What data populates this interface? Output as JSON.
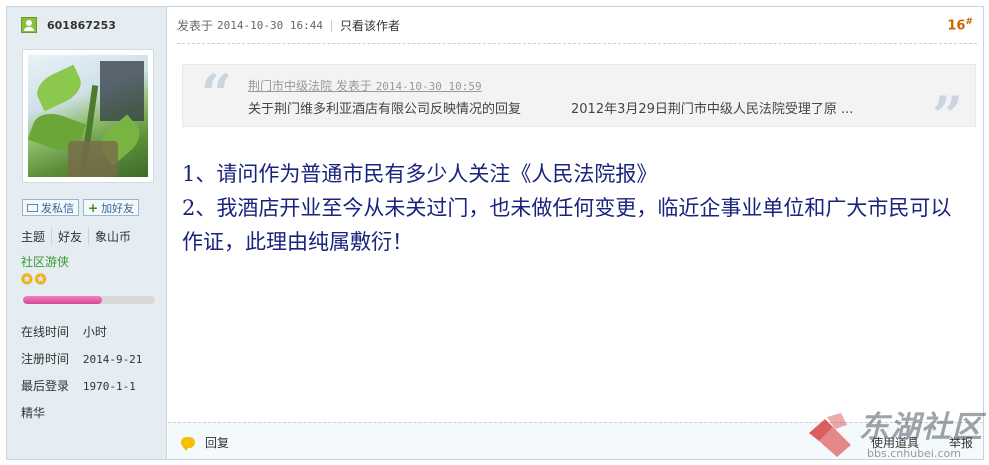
{
  "user": {
    "name": "601867253",
    "send_message": "发私信",
    "add_friend": "加好友",
    "stats": [
      "主题",
      "好友",
      "象山币"
    ],
    "group": "社区游侠",
    "level_progress": 0.6,
    "online_label": "在线时间",
    "online_value": "小时",
    "register_label": "注册时间",
    "register_value": "2014-9-21",
    "last_login_label": "最后登录",
    "last_login_value": "1970-1-1",
    "essence_label": "精华"
  },
  "post": {
    "posted_label": "发表于",
    "posted_date": "2014-10-30 16:44",
    "only_author": "只看该作者",
    "floor_num": "16",
    "floor_mark": "#"
  },
  "quote": {
    "author": "荆门市中级法院",
    "posted_label": "发表于",
    "posted_date": "2014-10-30 10:59",
    "title": "关于荆门维多利亚酒店有限公司反映情况的回复",
    "excerpt": "2012年3月29日荆门市中级人民法院受理了原 ..."
  },
  "body": {
    "line1": "1、请问作为普通市民有多少人关注《人民法院报》",
    "line2": "2、我酒店开业至今从未关过门，也未做任何变更，临近企事业单位和广大市民可以作证，此理由纯属敷衍！"
  },
  "footer": {
    "reply": "回复",
    "use_item": "使用道具",
    "report": "举报"
  },
  "watermark": {
    "brand": "东湖社区",
    "url": "bbs.cnhubei.com"
  },
  "colors": {
    "sidebar_bg": "#e5edf2",
    "body_text": "#1a237e",
    "floor": "#cc6600",
    "group": "#339933"
  }
}
